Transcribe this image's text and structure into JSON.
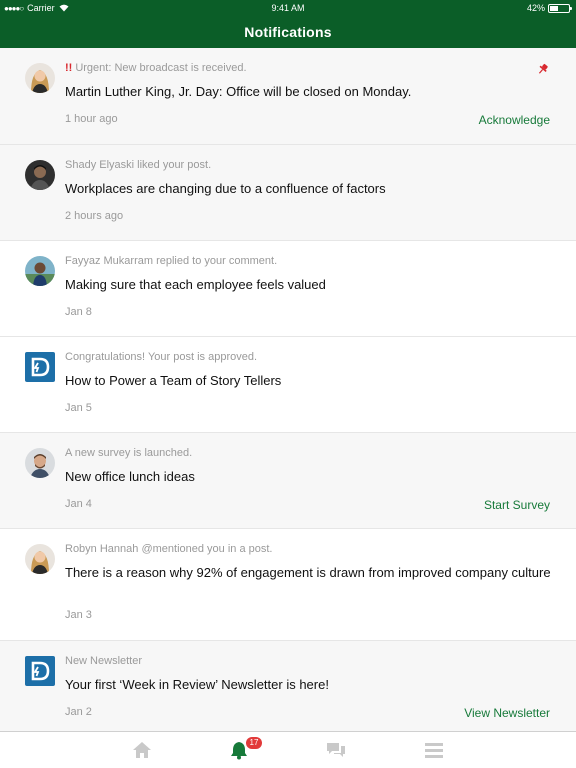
{
  "status_bar": {
    "carrier": "Carrier",
    "time": "9:41 AM",
    "battery": "42%",
    "battery_level": 0.42
  },
  "header": {
    "title": "Notifications"
  },
  "notifications": [
    {
      "avatar": "robyn-avatar",
      "urgent_mark": "!!",
      "meta": "Urgent: New broadcast is received.",
      "message": "Martin Luther King, Jr. Day: Office will be closed on Monday.",
      "time": "1 hour ago",
      "action": "Acknowledge",
      "pinned": true,
      "shaded": true
    },
    {
      "avatar": "shady-avatar",
      "meta": "Shady Elyaski liked your post.",
      "message": "Workplaces are changing due to a confluence of factors",
      "time": "2 hours ago",
      "shaded": true
    },
    {
      "avatar": "fayyaz-avatar",
      "meta": "Fayyaz Mukarram replied to your comment.",
      "message": "Making sure that each employee feels valued",
      "time": "Jan 8",
      "shaded": false
    },
    {
      "avatar": "app-logo-icon",
      "meta": "Congratulations! Your post is approved.",
      "message": "How to Power a Team of Story Tellers",
      "time": "Jan 5",
      "shaded": false
    },
    {
      "avatar": "survey-avatar",
      "meta": "A new survey is launched.",
      "message": "New office lunch ideas",
      "time": "Jan 4",
      "action": "Start Survey",
      "shaded": true
    },
    {
      "avatar": "robyn-avatar",
      "meta": "Robyn Hannah @mentioned you in a post.",
      "message": "There is a reason why 92% of engagement is drawn from improved company culture",
      "time": "Jan 3",
      "shaded": false
    },
    {
      "avatar": "app-logo-icon",
      "meta": "New Newsletter",
      "message": "Your first ‘Week in Review’ Newsletter is here!",
      "time": "Jan 2",
      "action": "View Newsletter",
      "shaded": true
    }
  ],
  "tabbar": {
    "tabs": [
      {
        "icon": "home-icon",
        "active": false
      },
      {
        "icon": "bell-icon",
        "active": true,
        "badge": "17"
      },
      {
        "icon": "chat-icon",
        "active": false
      },
      {
        "icon": "menu-icon",
        "active": false
      }
    ]
  },
  "colors": {
    "header_bg": "#0b5e28",
    "accent": "#177a3a",
    "urgent": "#d8282e",
    "badge": "#e23a3a",
    "inactive_icon": "#c9c9c9"
  }
}
